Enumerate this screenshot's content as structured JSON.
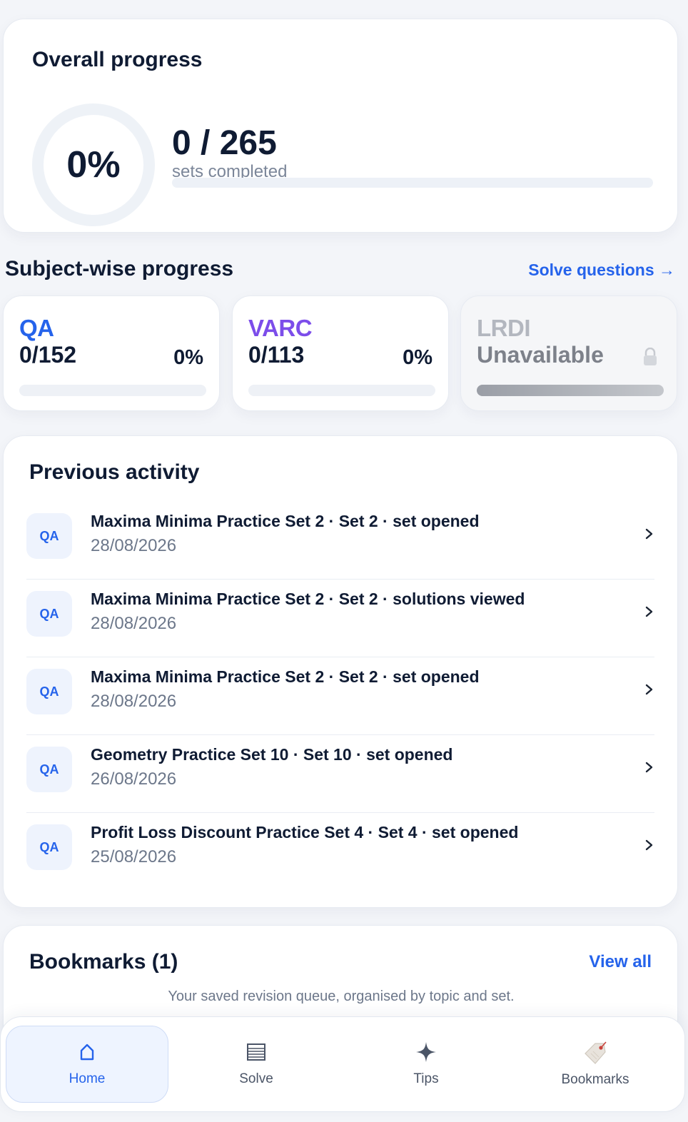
{
  "overall": {
    "title": "Overall progress",
    "percent_label": "0%",
    "sets_count": "0 / 265",
    "sets_label": "sets completed",
    "progress": 0
  },
  "subjects": {
    "title": "Subject-wise progress",
    "solve_link": "Solve questions →",
    "items": [
      {
        "name": "QA",
        "count": "0/152",
        "percent": "0%",
        "progress": 0,
        "color": "#2563eb"
      },
      {
        "name": "VARC",
        "count": "0/113",
        "percent": "0%",
        "progress": 0,
        "color": "#7c4dea"
      },
      {
        "name": "LRDI",
        "count": "Unavailable",
        "locked": true,
        "color": "#b3b7bf"
      }
    ]
  },
  "activity": {
    "title": "Previous activity",
    "items": [
      {
        "badge": "QA",
        "text": "Maxima Minima Practice Set 2 · Set 2 · set opened",
        "date": "28/08/2026"
      },
      {
        "badge": "QA",
        "text": "Maxima Minima Practice Set 2 · Set 2 · solutions viewed",
        "date": "28/08/2026"
      },
      {
        "badge": "QA",
        "text": "Maxima Minima Practice Set 2 · Set 2 · set opened",
        "date": "28/08/2026"
      },
      {
        "badge": "QA",
        "text": "Geometry Practice Set 10 · Set 10 · set opened",
        "date": "26/08/2026"
      },
      {
        "badge": "QA",
        "text": "Profit Loss Discount Practice Set 4 · Set 4 · set opened",
        "date": "25/08/2026"
      }
    ]
  },
  "bookmarks": {
    "title": "Bookmarks (1)",
    "view_all": "View all",
    "subtitle": "Your saved revision queue, organised by topic and set."
  },
  "nav": {
    "home": {
      "label": "Home",
      "icon": "home-icon",
      "active": true
    },
    "solve": {
      "label": "Solve",
      "icon": "list-icon"
    },
    "tips": {
      "label": "Tips",
      "icon": "sparkle-icon"
    },
    "bookmarks": {
      "label": "Bookmarks",
      "icon": "bookmark-tag-icon"
    }
  },
  "colors": {
    "accent": "#2563eb",
    "varc": "#7c4dea",
    "text": "#0f1b33",
    "muted": "#6c778a"
  }
}
